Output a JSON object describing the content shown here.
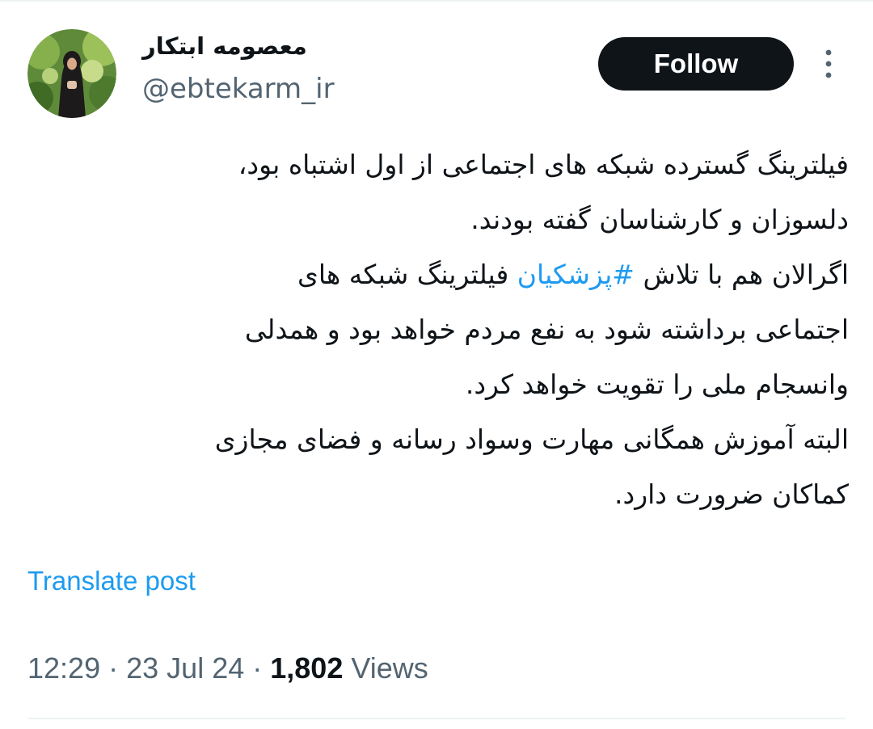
{
  "author": {
    "display_name": "معصومه ابتکار",
    "handle": "@ebtekarm_ir",
    "avatar_icon": "profile-photo"
  },
  "follow_label": "Follow",
  "more_icon": "more-options-vertical-icon",
  "tweet": {
    "lines": [
      "فیلترینگ گسترده شبکه های اجتماعی از اول اشتباه بود،",
      "دلسوزان و کارشناسان گفته بودند.",
      {
        "before": "اگرالان هم با تلاش ",
        "hashtag": "#پزشکیان",
        "after": " فیلترینگ شبکه های"
      },
      "اجتماعی برداشته شود به نفع مردم خواهد بود و همدلی",
      "وانسجام ملی را تقویت خواهد کرد.",
      "البته آموزش همگانی مهارت وسواد رسانه و فضای مجازی",
      "کماکان ضرورت دارد."
    ]
  },
  "translate_label": "Translate post",
  "meta": {
    "time": "12:29",
    "separator": "·",
    "date": "23 Jul 24",
    "views_count": "1,802",
    "views_label": "Views"
  },
  "colors": {
    "link": "#1d9bf0",
    "text": "#0f1419",
    "muted": "#536471",
    "button_bg": "#0f1419"
  }
}
